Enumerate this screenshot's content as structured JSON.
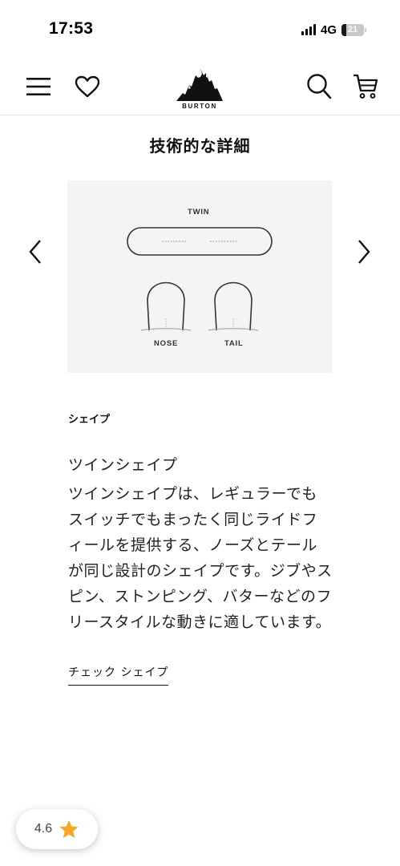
{
  "status_bar": {
    "time": "17:53",
    "network": "4G",
    "battery": "21",
    "battery_level": 0.21
  },
  "header": {
    "logo_text": "BURTON",
    "icons": [
      "menu-icon",
      "heart-icon",
      "search-icon",
      "cart-icon"
    ]
  },
  "section": {
    "title": "技術的な詳細"
  },
  "diagram": {
    "top_label": "TWIN",
    "nose_label": "NOSE",
    "tail_label": "TAIL"
  },
  "spec": {
    "label": "シェイプ",
    "name": "ツインシェイプ",
    "description": "ツインシェイプは、レギュラーでもスイッチでもまったく同じライドフィールを提供する、ノーズとテールが同じ設計のシェイプです。ジブやスピン、ストンピング、バターなどのフリースタイルな動きに適しています。",
    "link": "チェック シェイプ"
  },
  "rating": {
    "value": "4.6",
    "star_color": "#f5a623"
  }
}
